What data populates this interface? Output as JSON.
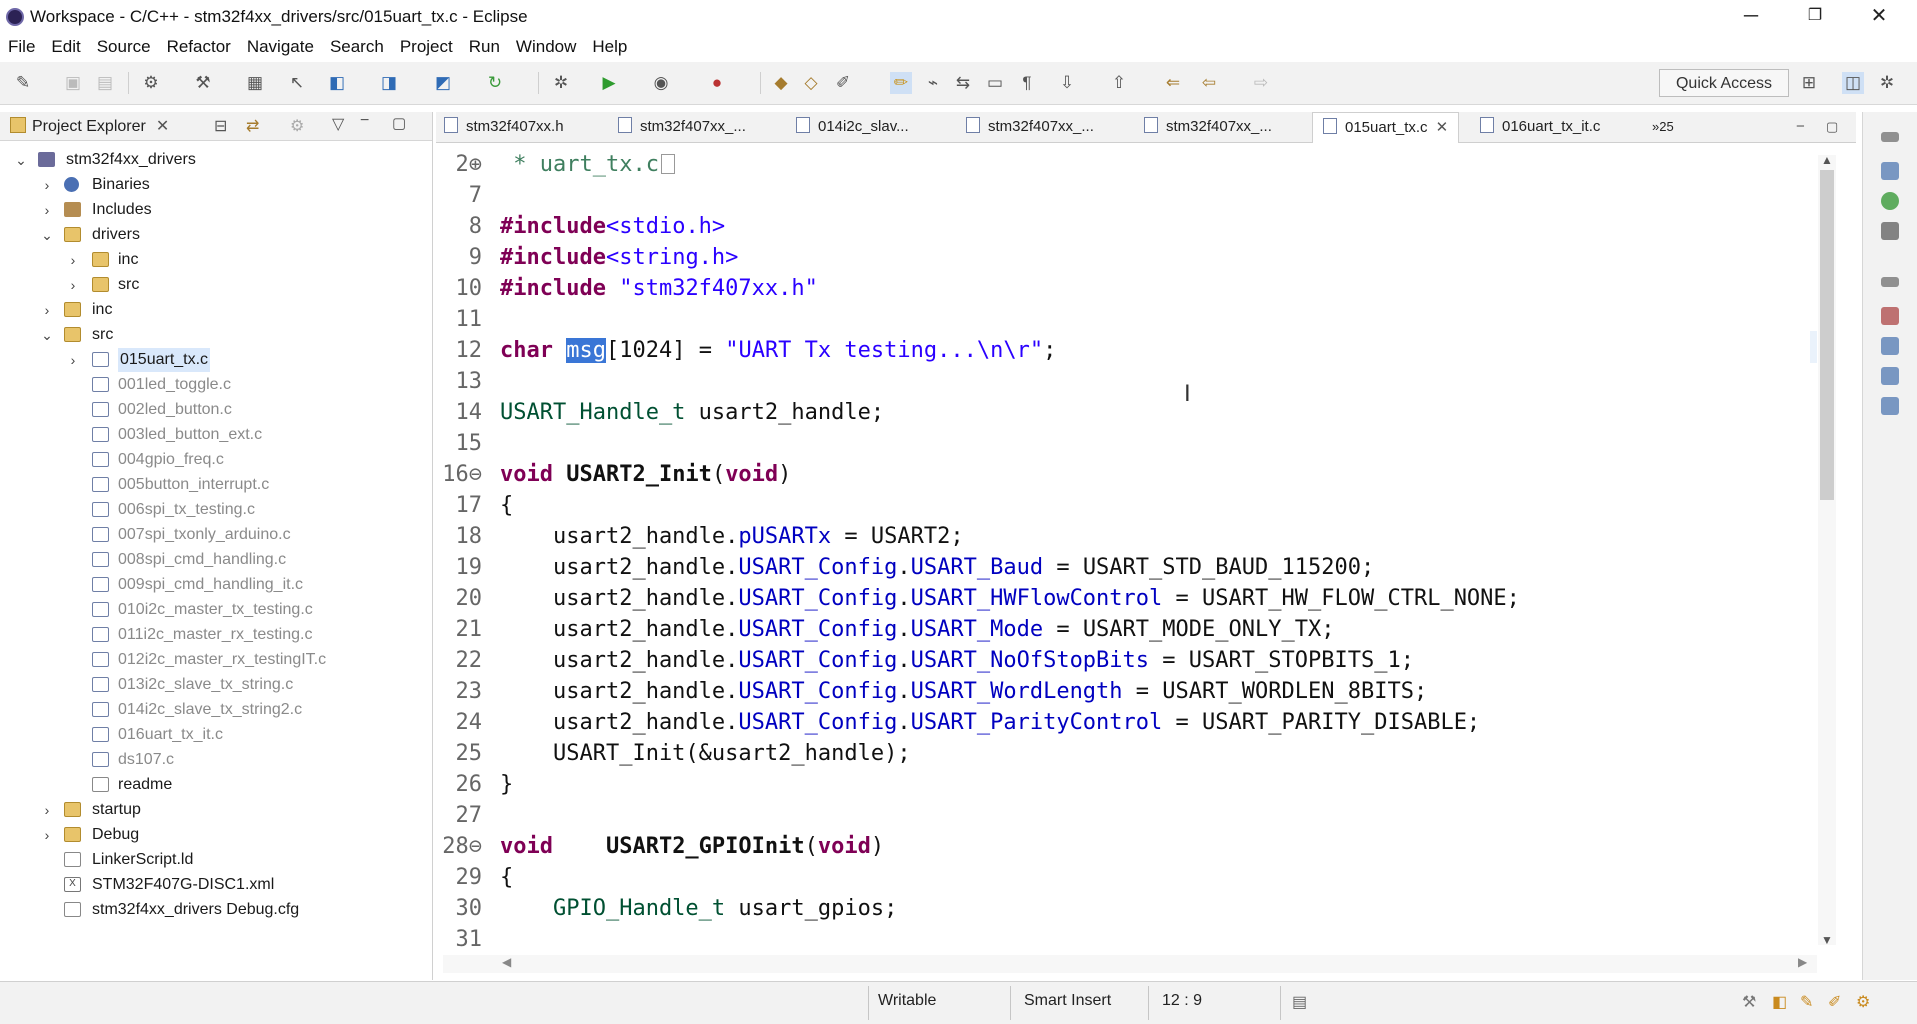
{
  "window": {
    "title": "Workspace - C/C++ - stm32f4xx_drivers/src/015uart_tx.c - Eclipse"
  },
  "menu": [
    "File",
    "Edit",
    "Source",
    "Refactor",
    "Navigate",
    "Search",
    "Project",
    "Run",
    "Window",
    "Help"
  ],
  "toolbar": {
    "quick_access": "Quick Access"
  },
  "explorer": {
    "tab_label": "Project Explorer",
    "project": "stm32f4xx_drivers",
    "items": {
      "binaries": "Binaries",
      "includes": "Includes",
      "drivers": "drivers",
      "drivers_inc": "inc",
      "drivers_src": "src",
      "inc": "inc",
      "src": "src",
      "startup": "startup",
      "debug": "Debug",
      "linker": "LinkerScript.ld",
      "xml": "STM32F407G-DISC1.xml",
      "cfg": "stm32f4xx_drivers Debug.cfg"
    },
    "src_files": [
      "015uart_tx.c",
      "001led_toggle.c",
      "002led_button.c",
      "003led_button_ext.c",
      "004gpio_freq.c",
      "005button_interrupt.c",
      "006spi_tx_testing.c",
      "007spi_txonly_arduino.c",
      "008spi_cmd_handling.c",
      "009spi_cmd_handling_it.c",
      "010i2c_master_tx_testing.c",
      "011i2c_master_rx_testing.c",
      "012i2c_master_rx_testingIT.c",
      "013i2c_slave_tx_string.c",
      "014i2c_slave_tx_string2.c",
      "016uart_tx_it.c",
      "ds107.c",
      "readme"
    ]
  },
  "editor_tabs": [
    "stm32f407xx.h",
    "stm32f407xx_...",
    "014i2c_slav...",
    "stm32f407xx_...",
    "stm32f407xx_...",
    "015uart_tx.c",
    "016uart_tx_it.c"
  ],
  "tab_overflow": "»25",
  "code": {
    "l2_num": "2⊕",
    "l2": " * uart_tx.c",
    "l7_num": "7",
    "l8_num": "8",
    "l8_kw": "#include",
    "l8_rest": "<stdio.h>",
    "l9_num": "9",
    "l9_kw": "#include",
    "l9_rest": "<string.h>",
    "l10_num": "10",
    "l10_kw": "#include",
    "l10_rest": " \"stm32f407xx.h\"",
    "l11_num": "11",
    "l12_num": "12",
    "l12_kw": "char",
    "l12_sel": "msg",
    "l12_a": "[1024] = ",
    "l12_str": "\"UART Tx testing...\\n\\r\"",
    "l12_end": ";",
    "l13_num": "13",
    "l14_num": "14",
    "l14_type": "USART_Handle_t",
    "l14_rest": " usart2_handle;",
    "l15_num": "15",
    "l16_num": "16⊖",
    "l16_kw": "void",
    "l16_fn": " USART2_Init",
    "l16_open": "(",
    "l16_kw2": "void",
    "l16_close": ")",
    "l17_num": "17",
    "l17": "{",
    "l18_num": "18",
    "l18_a": "    usart2_handle.",
    "l18_f": "pUSARTx",
    "l18_b": " = USART2;",
    "l19_num": "19",
    "l19_a": "    usart2_handle.",
    "l19_f1": "USART_Config",
    "l19_dot": ".",
    "l19_f2": "USART_Baud",
    "l19_b": " = USART_STD_BAUD_115200;",
    "l20_num": "20",
    "l20_a": "    usart2_handle.",
    "l20_f1": "USART_Config",
    "l20_dot": ".",
    "l20_f2": "USART_HWFlowControl",
    "l20_b": " = USART_HW_FLOW_CTRL_NONE;",
    "l21_num": "21",
    "l21_a": "    usart2_handle.",
    "l21_f1": "USART_Config",
    "l21_dot": ".",
    "l21_f2": "USART_Mode",
    "l21_b": " = USART_MODE_ONLY_TX;",
    "l22_num": "22",
    "l22_a": "    usart2_handle.",
    "l22_f1": "USART_Config",
    "l22_dot": ".",
    "l22_f2": "USART_NoOfStopBits",
    "l22_b": " = USART_STOPBITS_1;",
    "l23_num": "23",
    "l23_a": "    usart2_handle.",
    "l23_f1": "USART_Config",
    "l23_dot": ".",
    "l23_f2": "USART_WordLength",
    "l23_b": " = USART_WORDLEN_8BITS;",
    "l24_num": "24",
    "l24_a": "    usart2_handle.",
    "l24_f1": "USART_Config",
    "l24_dot": ".",
    "l24_f2": "USART_ParityControl",
    "l24_b": " = USART_PARITY_DISABLE;",
    "l25_num": "25",
    "l25": "    USART_Init(&usart2_handle);",
    "l26_num": "26",
    "l26": "}",
    "l27_num": "27",
    "l28_num": "28⊖",
    "l28_kw": "void",
    "l28_fn": "    USART2_GPIOInit",
    "l28_open": "(",
    "l28_kw2": "void",
    "l28_close": ")",
    "l29_num": "29",
    "l29": "{",
    "l30_num": "30",
    "l30_type": "    GPIO_Handle_t",
    "l30_rest": " usart_gpios;",
    "l31_num": "31"
  },
  "status": {
    "writable": "Writable",
    "insert_mode": "Smart Insert",
    "position": "12 : 9"
  },
  "colors": {
    "keyword": "#7f0055",
    "string": "#2a00ff",
    "field": "#0000c0",
    "type": "#005032",
    "selection": "#3a76d6"
  }
}
